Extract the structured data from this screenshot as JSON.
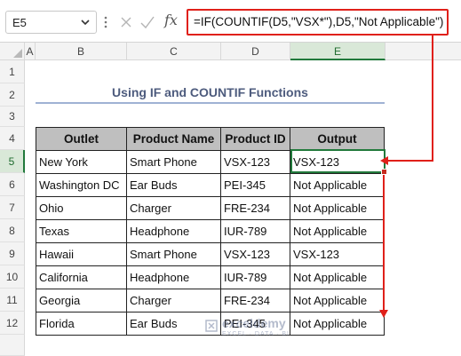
{
  "formula_bar": {
    "name_box": "E5",
    "fx_label": "fx",
    "formula": "=IF(COUNTIF(D5,\"VSX*\"),D5,\"Not Applicable\")"
  },
  "columns": [
    "A",
    "B",
    "C",
    "D",
    "E"
  ],
  "selected_column": "E",
  "rows": [
    "1",
    "2",
    "3",
    "4",
    "5",
    "6",
    "7",
    "8",
    "9",
    "10",
    "11",
    "12"
  ],
  "selected_row": "5",
  "title": "Using IF and COUNTIF Functions",
  "table": {
    "headers": [
      "Outlet",
      "Product Name",
      "Product ID",
      "Output"
    ],
    "rows": [
      [
        "New York",
        "Smart Phone",
        "VSX-123",
        "VSX-123"
      ],
      [
        "Washington DC",
        "Ear Buds",
        "PEI-345",
        "Not Applicable"
      ],
      [
        "Ohio",
        "Charger",
        "FRE-234",
        "Not Applicable"
      ],
      [
        "Texas",
        "Headphone",
        "IUR-789",
        "Not Applicable"
      ],
      [
        "Hawaii",
        "Smart Phone",
        "VSX-123",
        "VSX-123"
      ],
      [
        "California",
        "Headphone",
        "IUR-789",
        "Not Applicable"
      ],
      [
        "Georgia",
        "Charger",
        "FRE-234",
        "Not Applicable"
      ],
      [
        "Florida",
        "Ear Buds",
        "PEI-345",
        "Not Applicable"
      ]
    ]
  },
  "watermark": {
    "name": "exceldemy",
    "tagline": "EXCEL · DATA · BI"
  },
  "colors": {
    "accent_red": "#e0201a",
    "selection_green": "#21793b",
    "header_fill": "#bfbfbf",
    "title_color": "#4d5b7d"
  }
}
